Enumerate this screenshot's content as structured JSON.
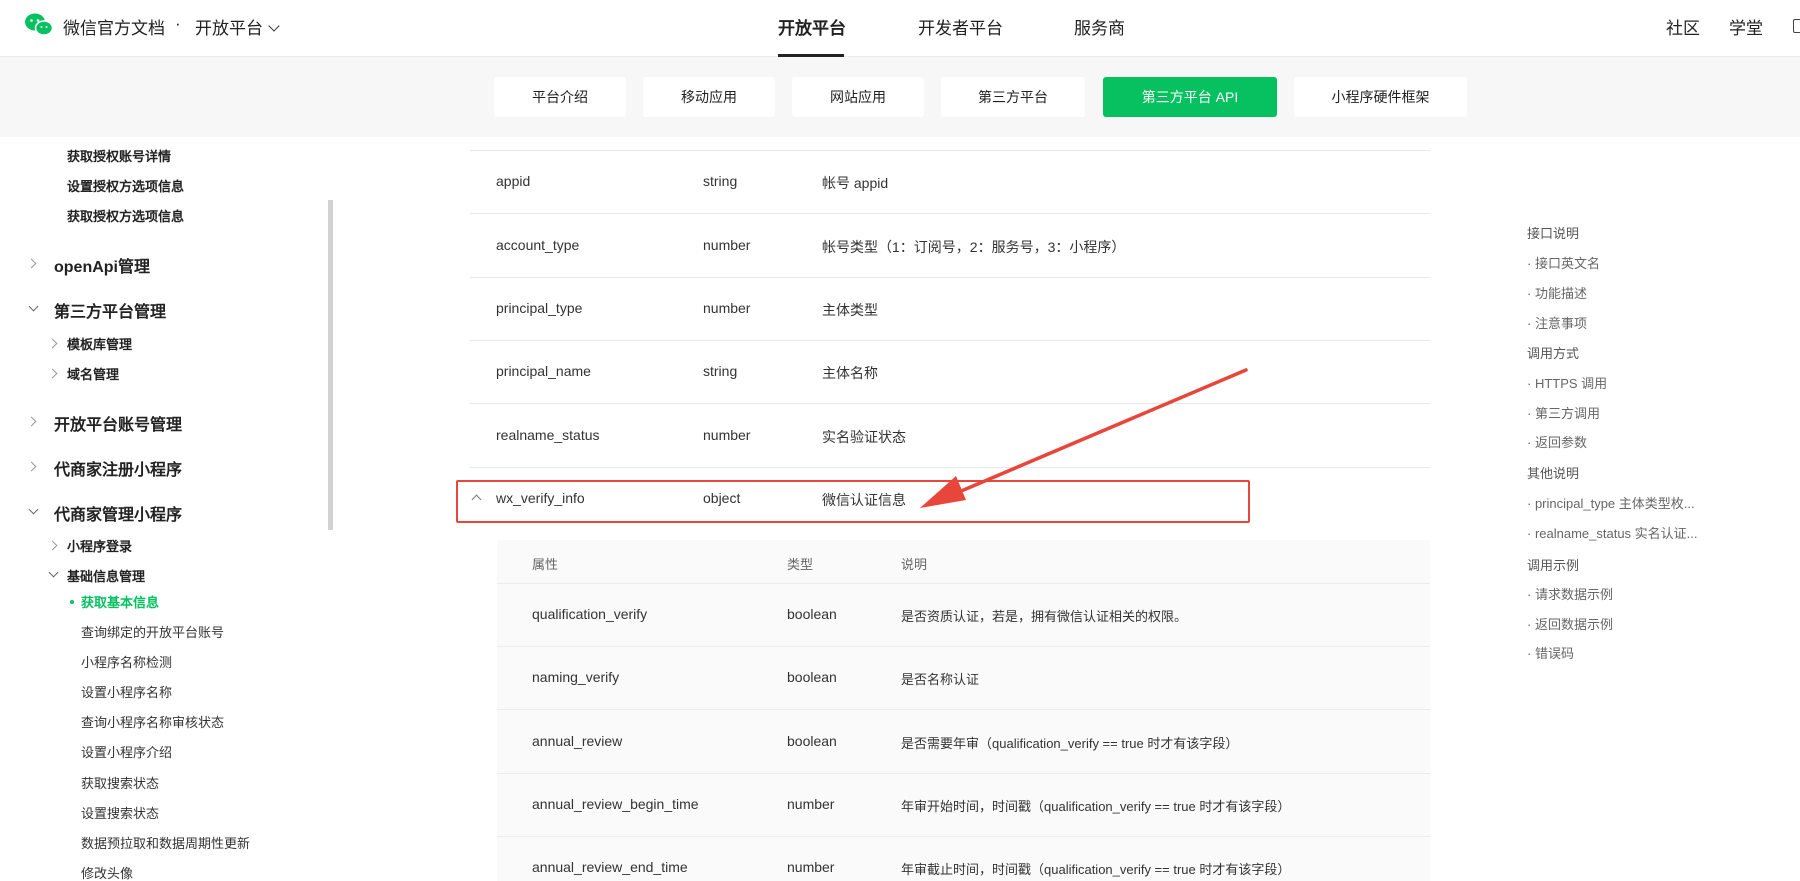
{
  "header": {
    "site_title": "微信官方文档",
    "separator": "·",
    "platform": "开放平台",
    "nav": [
      {
        "label": "开放平台",
        "active": true
      },
      {
        "label": "开发者平台",
        "active": false
      },
      {
        "label": "服务商",
        "active": false
      }
    ],
    "right_links": [
      "社区",
      "学堂"
    ]
  },
  "subnav": [
    {
      "label": "平台介绍",
      "active": false
    },
    {
      "label": "移动应用",
      "active": false
    },
    {
      "label": "网站应用",
      "active": false
    },
    {
      "label": "第三方平台",
      "active": false
    },
    {
      "label": "第三方平台 API",
      "active": true
    },
    {
      "label": "小程序硬件框架",
      "active": false
    }
  ],
  "sidebar": {
    "items": [
      {
        "label": "获取授权账号详情",
        "level": 2,
        "arrow": "none"
      },
      {
        "label": "设置授权方选项信息",
        "level": 2,
        "arrow": "none"
      },
      {
        "label": "获取授权方选项信息",
        "level": 2,
        "arrow": "none"
      },
      {
        "label": "openApi管理",
        "level": 1,
        "arrow": "right"
      },
      {
        "label": "第三方平台管理",
        "level": 1,
        "arrow": "down"
      },
      {
        "label": "模板库管理",
        "level": 2,
        "arrow": "right"
      },
      {
        "label": "域名管理",
        "level": 2,
        "arrow": "right"
      },
      {
        "label": "开放平台账号管理",
        "level": 1,
        "arrow": "right"
      },
      {
        "label": "代商家注册小程序",
        "level": 1,
        "arrow": "right"
      },
      {
        "label": "代商家管理小程序",
        "level": 1,
        "arrow": "down"
      },
      {
        "label": "小程序登录",
        "level": 2,
        "arrow": "right"
      },
      {
        "label": "基础信息管理",
        "level": 2,
        "arrow": "down"
      },
      {
        "label": "获取基本信息",
        "level": 3,
        "arrow": "none",
        "active": true
      },
      {
        "label": "查询绑定的开放平台账号",
        "level": 3,
        "arrow": "none"
      },
      {
        "label": "小程序名称检测",
        "level": 3,
        "arrow": "none"
      },
      {
        "label": "设置小程序名称",
        "level": 3,
        "arrow": "none"
      },
      {
        "label": "查询小程序名称审核状态",
        "level": 3,
        "arrow": "none"
      },
      {
        "label": "设置小程序介绍",
        "level": 3,
        "arrow": "none"
      },
      {
        "label": "获取搜索状态",
        "level": 3,
        "arrow": "none"
      },
      {
        "label": "设置搜索状态",
        "level": 3,
        "arrow": "none"
      },
      {
        "label": "数据预拉取和数据周期性更新",
        "level": 3,
        "arrow": "none"
      },
      {
        "label": "修改头像",
        "level": 3,
        "arrow": "none"
      }
    ]
  },
  "table": {
    "rows": [
      {
        "name": "appid",
        "type": "string",
        "desc": "帐号 appid"
      },
      {
        "name": "account_type",
        "type": "number",
        "desc": "帐号类型（1：订阅号，2：服务号，3：小程序）"
      },
      {
        "name": "principal_type",
        "type": "number",
        "desc": "主体类型"
      },
      {
        "name": "principal_name",
        "type": "string",
        "desc": "主体名称"
      },
      {
        "name": "realname_status",
        "type": "number",
        "desc": "实名验证状态"
      },
      {
        "name": "wx_verify_info",
        "type": "object",
        "desc": "微信认证信息"
      }
    ],
    "nested_headers": [
      "属性",
      "类型",
      "说明"
    ],
    "nested_rows": [
      {
        "name": "qualification_verify",
        "type": "boolean",
        "desc": "是否资质认证，若是，拥有微信认证相关的权限。"
      },
      {
        "name": "naming_verify",
        "type": "boolean",
        "desc": "是否名称认证"
      },
      {
        "name": "annual_review",
        "type": "boolean",
        "desc": "是否需要年审（qualification_verify == true 时才有该字段）"
      },
      {
        "name": "annual_review_begin_time",
        "type": "number",
        "desc": "年审开始时间，时间戳（qualification_verify == true 时才有该字段）"
      },
      {
        "name": "annual_review_end_time",
        "type": "number",
        "desc": "年审截止时间，时间戳（qualification_verify == true 时才有该字段）"
      }
    ]
  },
  "toc": [
    {
      "label": "接口说明",
      "sec": true
    },
    {
      "label": "· 接口英文名",
      "sec": false
    },
    {
      "label": "· 功能描述",
      "sec": false
    },
    {
      "label": "· 注意事项",
      "sec": false
    },
    {
      "label": "调用方式",
      "sec": true
    },
    {
      "label": "· HTTPS 调用",
      "sec": false
    },
    {
      "label": "· 第三方调用",
      "sec": false
    },
    {
      "label": "· 返回参数",
      "sec": false
    },
    {
      "label": "其他说明",
      "sec": true
    },
    {
      "label": "· principal_type 主体类型枚...",
      "sec": false
    },
    {
      "label": "· realname_status 实名认证...",
      "sec": false
    },
    {
      "label": "调用示例",
      "sec": true
    },
    {
      "label": "· 请求数据示例",
      "sec": false
    },
    {
      "label": "· 返回数据示例",
      "sec": false
    },
    {
      "label": "· 错误码",
      "sec": false
    }
  ],
  "colors": {
    "brand": "#07c160",
    "annotation": "#e8463b"
  },
  "icons": [
    "wechat-logo-icon",
    "chevron-down-icon",
    "chevron-right-icon",
    "chevron-up-icon",
    "window-icon"
  ]
}
